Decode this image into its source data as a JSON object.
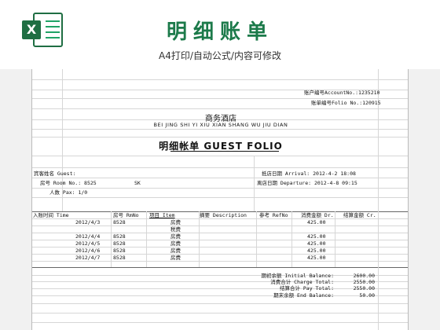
{
  "header": {
    "app_icon": "excel-icon",
    "title": "明细账单",
    "subtitle": "A4打印/自动公式/内容可修改"
  },
  "folio": {
    "account_no": "账户编号AccountNo.:1235210",
    "folio_no": "账单编号Folio No.:120915",
    "hotel_name_cn": "商务酒店",
    "hotel_name_en": "BEI JING SHI YI XIU XIAN SHANG WU JIU DIAN",
    "heading": "明细帐单  GUEST  FOLIO",
    "guest_label": "宾客姓名 Guest:",
    "arrival": "抵店日期 Arrival: 2012-4-2  18:08",
    "room_label": "房号 Room No.: 8525",
    "room_type": "SK",
    "departure": "离店日期 Departure: 2012-4-8  09:15",
    "pax": "人数 Pax: 1/0"
  },
  "table": {
    "columns": [
      "入账时间 Time",
      "房号 RmNo",
      "项目 Item",
      "摘要 Description",
      "参考 RefNo",
      "消费金额 Dr.",
      "结算金额 Cr."
    ],
    "rows": [
      {
        "date": "2012/4/3",
        "room": "8528",
        "item": "房费",
        "amount": "425.00"
      },
      {
        "date": "",
        "room": "",
        "item": "税费",
        "amount": ""
      },
      {
        "date": "2012/4/4",
        "room": "8528",
        "item": "房费",
        "amount": "425.00"
      },
      {
        "date": "2012/4/5",
        "room": "8528",
        "item": "房费",
        "amount": "425.00"
      },
      {
        "date": "2012/4/6",
        "room": "8528",
        "item": "房费",
        "amount": "425.00"
      },
      {
        "date": "2012/4/7",
        "room": "8528",
        "item": "房费",
        "amount": "425.00"
      }
    ]
  },
  "summary": [
    {
      "label": "期初余额 Initial Balance:",
      "value": "2600.00"
    },
    {
      "label": "消费合计 Charge Total:",
      "value": "2550.00"
    },
    {
      "label": "结算合计 Pay Total:",
      "value": "2550.00"
    },
    {
      "label": "期末余额 End Balance:",
      "value": "50.00"
    }
  ]
}
